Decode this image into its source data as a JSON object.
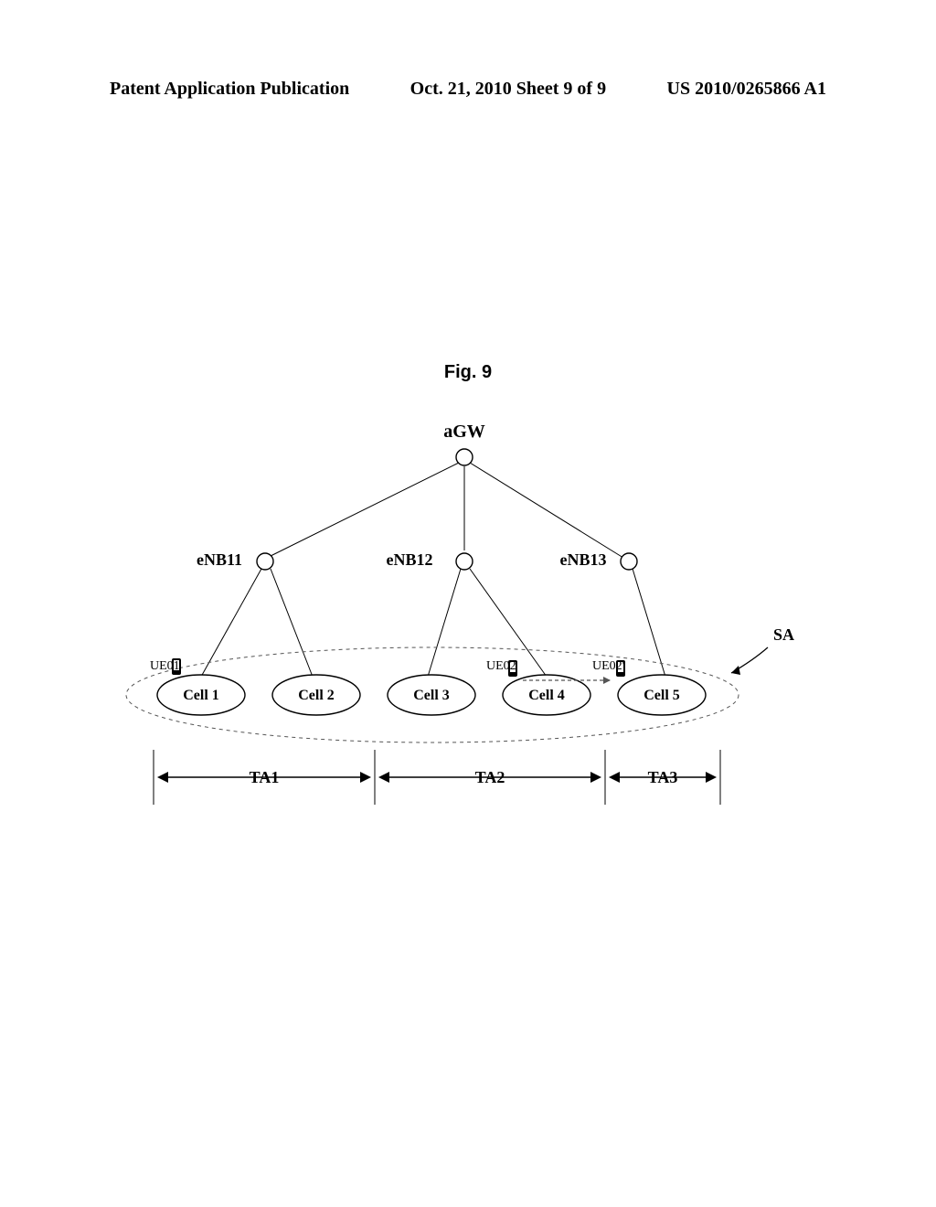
{
  "header": {
    "left": "Patent Application Publication",
    "center": "Oct. 21, 2010  Sheet 9 of 9",
    "right": "US 2010/0265866 A1"
  },
  "figure": {
    "label": "Fig. 9",
    "agw": "aGW",
    "enb": [
      "eNB11",
      "eNB12",
      "eNB13"
    ],
    "sa": "SA",
    "ue": {
      "ue01": "UE01",
      "ue02": "UE02",
      "ue02_prime": "UE02'"
    },
    "cells": [
      "Cell 1",
      "Cell 2",
      "Cell 3",
      "Cell 4",
      "Cell 5"
    ],
    "tas": [
      "TA1",
      "TA2",
      "TA3"
    ]
  },
  "chart_data": {
    "type": "diagram",
    "title": "Fig. 9",
    "root": "aGW",
    "children": [
      {
        "name": "eNB11",
        "cells": [
          "Cell 1",
          "Cell 2"
        ]
      },
      {
        "name": "eNB12",
        "cells": [
          "Cell 3",
          "Cell 4"
        ]
      },
      {
        "name": "eNB13",
        "cells": [
          "Cell 5"
        ]
      }
    ],
    "service_area": {
      "label": "SA",
      "cells": [
        "Cell 1",
        "Cell 2",
        "Cell 3",
        "Cell 4",
        "Cell 5"
      ]
    },
    "tracking_areas": [
      {
        "name": "TA1",
        "cells": [
          "Cell 1",
          "Cell 2"
        ]
      },
      {
        "name": "TA2",
        "cells": [
          "Cell 3",
          "Cell 4"
        ]
      },
      {
        "name": "TA3",
        "cells": [
          "Cell 5"
        ]
      }
    ],
    "ues": [
      {
        "name": "UE01",
        "at": "Cell 1"
      },
      {
        "name": "UE02",
        "at": "Cell 4",
        "moves_to": "Cell 5",
        "as": "UE02'"
      }
    ]
  }
}
